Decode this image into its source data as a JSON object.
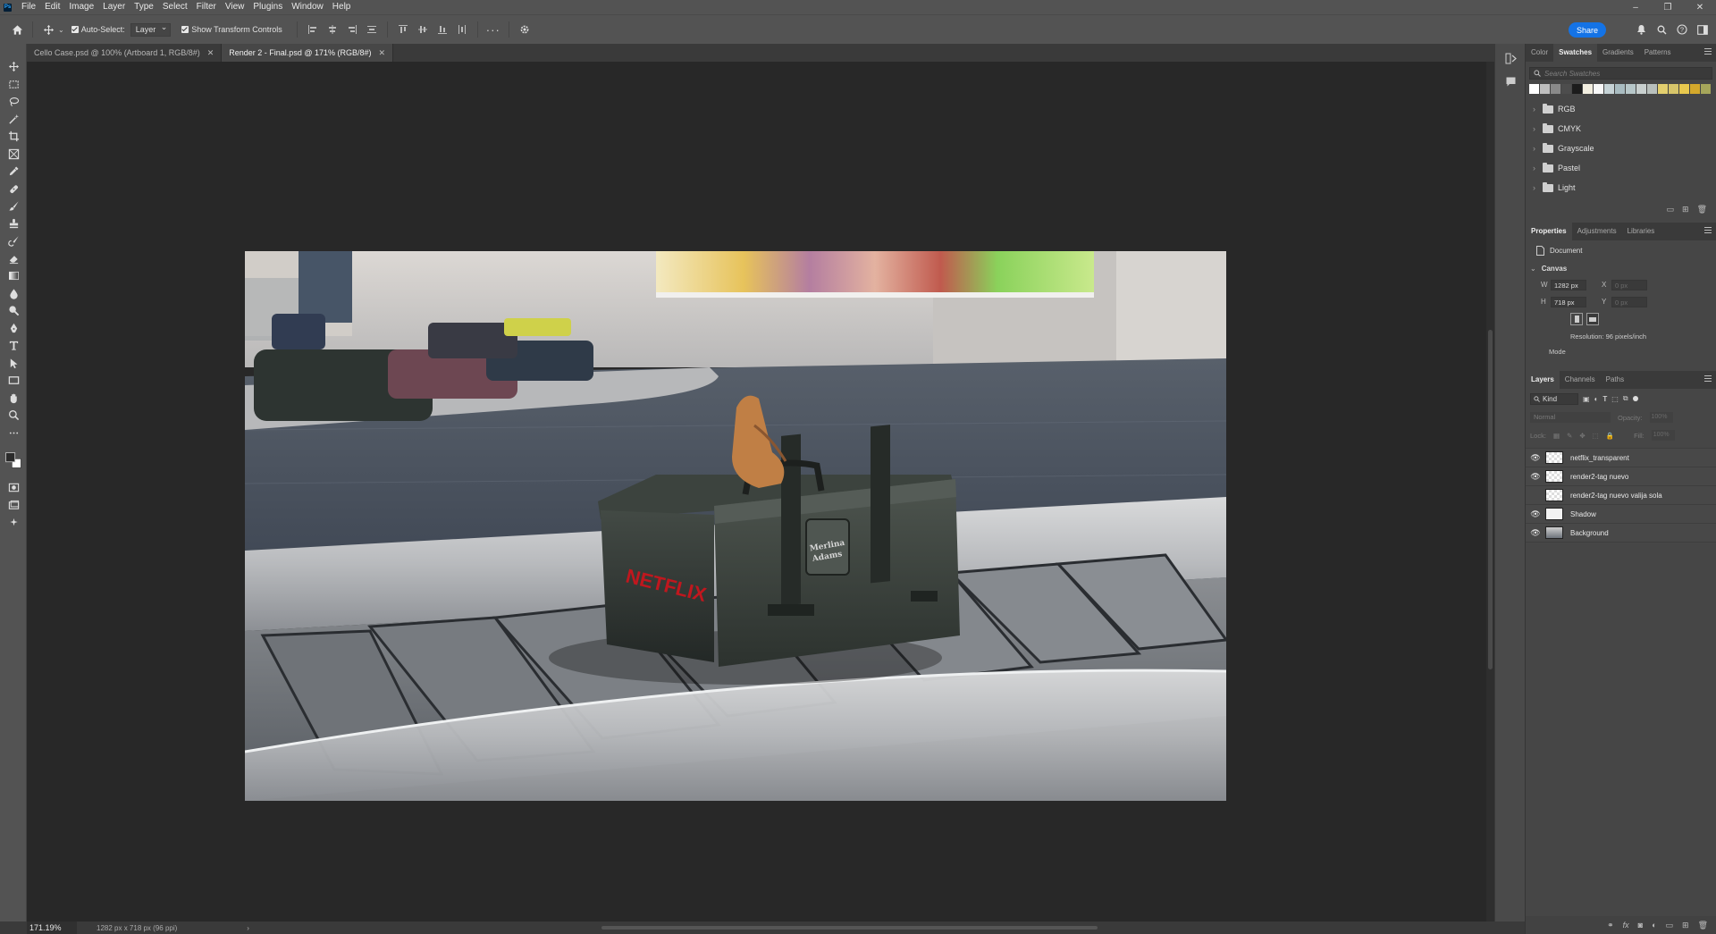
{
  "app": {
    "logo_text": "Ps"
  },
  "menu": [
    "File",
    "Edit",
    "Image",
    "Layer",
    "Type",
    "Select",
    "Filter",
    "View",
    "Plugins",
    "Window",
    "Help"
  ],
  "options_bar": {
    "auto_select_label": "Auto-Select:",
    "auto_select_value": "Layer",
    "show_transform_label": "Show Transform Controls",
    "share_label": "Share"
  },
  "tabs": [
    {
      "label": "Cello Case.psd @ 100% (Artboard 1, RGB/8#)",
      "active": false
    },
    {
      "label": "Render 2 - Final.psd @ 171% (RGB/8#)",
      "active": true
    }
  ],
  "canvas": {
    "tag_text_line1": "Merlina",
    "tag_text_line2": "Adams",
    "brand_text": "NETFLIX"
  },
  "status": {
    "zoom": "171.19%",
    "doc_info": "1282 px x 718 px (96 ppi)"
  },
  "swatches": {
    "tabs": [
      "Color",
      "Swatches",
      "Gradients",
      "Patterns"
    ],
    "search_placeholder": "Search Swatches",
    "colors": [
      "#ffffff",
      "#bfbfbf",
      "#8a8a8a",
      "#4d4d4d",
      "#1c1c1c",
      "#f2eee0",
      "#f8f8f8",
      "#c6d3d6",
      "#a9bcc1",
      "#b7c7c9",
      "#c9d0cf",
      "#b9c0bd",
      "#e3cf6e",
      "#d7c56a",
      "#e8c84e",
      "#d4a82b",
      "#a6a65b"
    ],
    "groups": [
      "RGB",
      "CMYK",
      "Grayscale",
      "Pastel",
      "Light"
    ]
  },
  "properties": {
    "tabs": [
      "Properties",
      "Adjustments",
      "Libraries"
    ],
    "doc_label": "Document",
    "section": "Canvas",
    "w_label": "W",
    "w_value": "1282 px",
    "h_label": "H",
    "h_value": "718 px",
    "x_label": "X",
    "x_value": "0 px",
    "y_label": "Y",
    "y_value": "0 px",
    "resolution": "Resolution: 96 pixels/inch",
    "mode_label": "Mode"
  },
  "layers": {
    "tabs": [
      "Layers",
      "Channels",
      "Paths"
    ],
    "filter_label": "Kind",
    "blend_mode": "Normal",
    "opacity_label": "Opacity:",
    "opacity_value": "100%",
    "lock_label": "Lock:",
    "fill_label": "Fill:",
    "fill_value": "100%",
    "items": [
      {
        "name": "netflix_transparent",
        "visible": true
      },
      {
        "name": "render2-tag nuevo",
        "visible": true
      },
      {
        "name": "render2-tag nuevo valija sola",
        "visible": false
      },
      {
        "name": "Shadow",
        "visible": true
      },
      {
        "name": "Background",
        "visible": true
      }
    ]
  }
}
